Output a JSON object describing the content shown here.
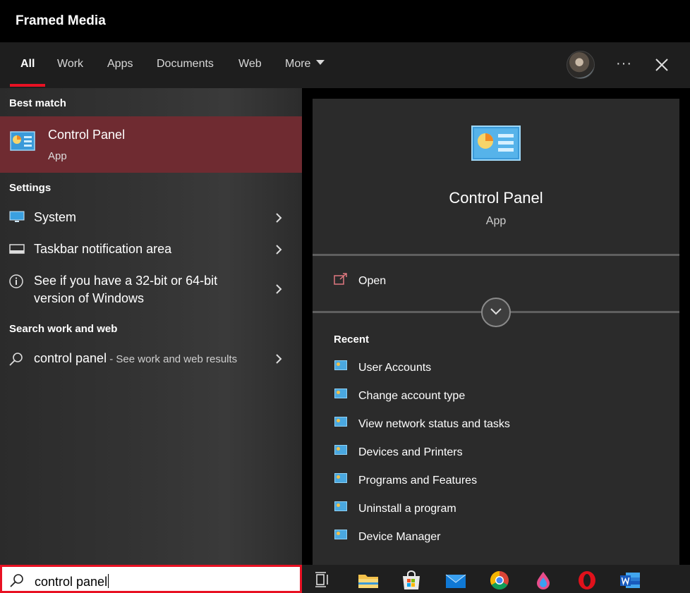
{
  "app": {
    "title": "Framed Media"
  },
  "tabs": [
    {
      "label": "All",
      "active": true
    },
    {
      "label": "Work"
    },
    {
      "label": "Apps"
    },
    {
      "label": "Documents"
    },
    {
      "label": "Web"
    },
    {
      "label": "More"
    }
  ],
  "icons": {
    "more_options": "ellipsis-icon",
    "close": "close-icon",
    "avatar": "user-avatar"
  },
  "left": {
    "best_match_header": "Best match",
    "best_match": {
      "title": "Control Panel",
      "subtitle": "App",
      "icon": "control-panel-icon"
    },
    "settings_header": "Settings",
    "settings": [
      {
        "label": "System",
        "icon": "monitor-icon"
      },
      {
        "label": "Taskbar notification area",
        "icon": "taskbar-icon"
      },
      {
        "label_line1": "See if you have a 32-bit or 64-bit",
        "label_line2": "version of Windows",
        "icon": "info-icon"
      }
    ],
    "web_header": "Search work and web",
    "web_result": {
      "query": "control panel",
      "suffix": " - See work and web results",
      "icon": "search-icon"
    }
  },
  "preview": {
    "title": "Control Panel",
    "subtitle": "App",
    "open_label": "Open",
    "recent_header": "Recent",
    "recent": [
      "User Accounts",
      "Change account type",
      "View network status and tasks",
      "Devices and Printers",
      "Programs and Features",
      "Uninstall a program",
      "Device Manager"
    ]
  },
  "taskbar": {
    "search_value": "control panel",
    "apps": [
      "task-view",
      "file-explorer",
      "microsoft-store",
      "mail",
      "chrome",
      "paint-3d",
      "opera",
      "word"
    ]
  },
  "colors": {
    "accent": "#e81123",
    "selected_row": "#6f2b31"
  }
}
